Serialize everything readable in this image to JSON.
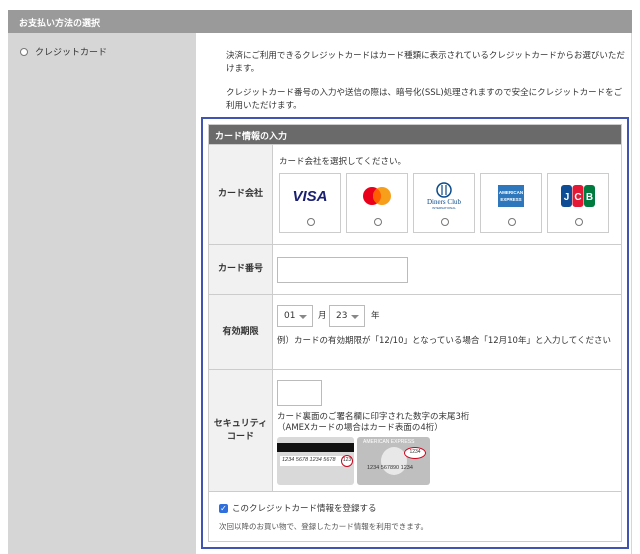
{
  "header": {
    "title": "お支払い方法の選択"
  },
  "payment_option": {
    "label": "クレジットカード"
  },
  "description": {
    "paragraph1": "決済にご利用できるクレジットカードはカード種類に表示されているクレジットカードからお選びいただけます。",
    "paragraph2": "クレジットカード番号の入力や送信の際は、暗号化(SSL)処理されますので安全にクレジットカードをご利用いただけます。"
  },
  "card_form": {
    "title": "カード情報の入力",
    "company": {
      "label": "カード会社",
      "instruction": "カード会社を選択してください。",
      "brands": [
        "VISA",
        "Mastercard",
        "Diners Club International",
        "American Express",
        "JCB"
      ]
    },
    "number": {
      "label": "カード番号",
      "value": ""
    },
    "expiry": {
      "label": "有効期限",
      "month": "01",
      "month_unit": "月",
      "year": "23",
      "year_unit": "年",
      "note": "例）カードの有効期限が「12/10」となっている場合「12月10年」と入力してください"
    },
    "security": {
      "label_line1": "セキュリティ",
      "label_line2": "コード",
      "value": "",
      "note_line1": "カード裏面のご署名欄に印字された数字の末尾3桁",
      "note_line2": "（AMEXカードの場合はカード表面の4桁）",
      "card1_number": "1234 5678 1234 5678",
      "card1_code": "123",
      "card2_brand": "AMERICAN EXPRESS",
      "card2_code": "1234",
      "card2_number": "1234 567890 1234"
    },
    "save": {
      "label": "このクレジットカード情報を登録する",
      "checked": true,
      "note": "次回以降のお買い物で、登録したカード情報を利用できます。"
    }
  },
  "colors": {
    "accent_border": "#4054b2",
    "header_bg": "#9a9a9a",
    "sidebar_bg": "#d6d6d6",
    "form_title_bg": "#6a6a6a",
    "checkbox": "#2f6fdd"
  },
  "icons": [
    "visa-logo",
    "mastercard-logo",
    "diners-logo",
    "amex-logo",
    "jcb-logo",
    "checkbox-checked-icon",
    "chevron-down-icon"
  ]
}
